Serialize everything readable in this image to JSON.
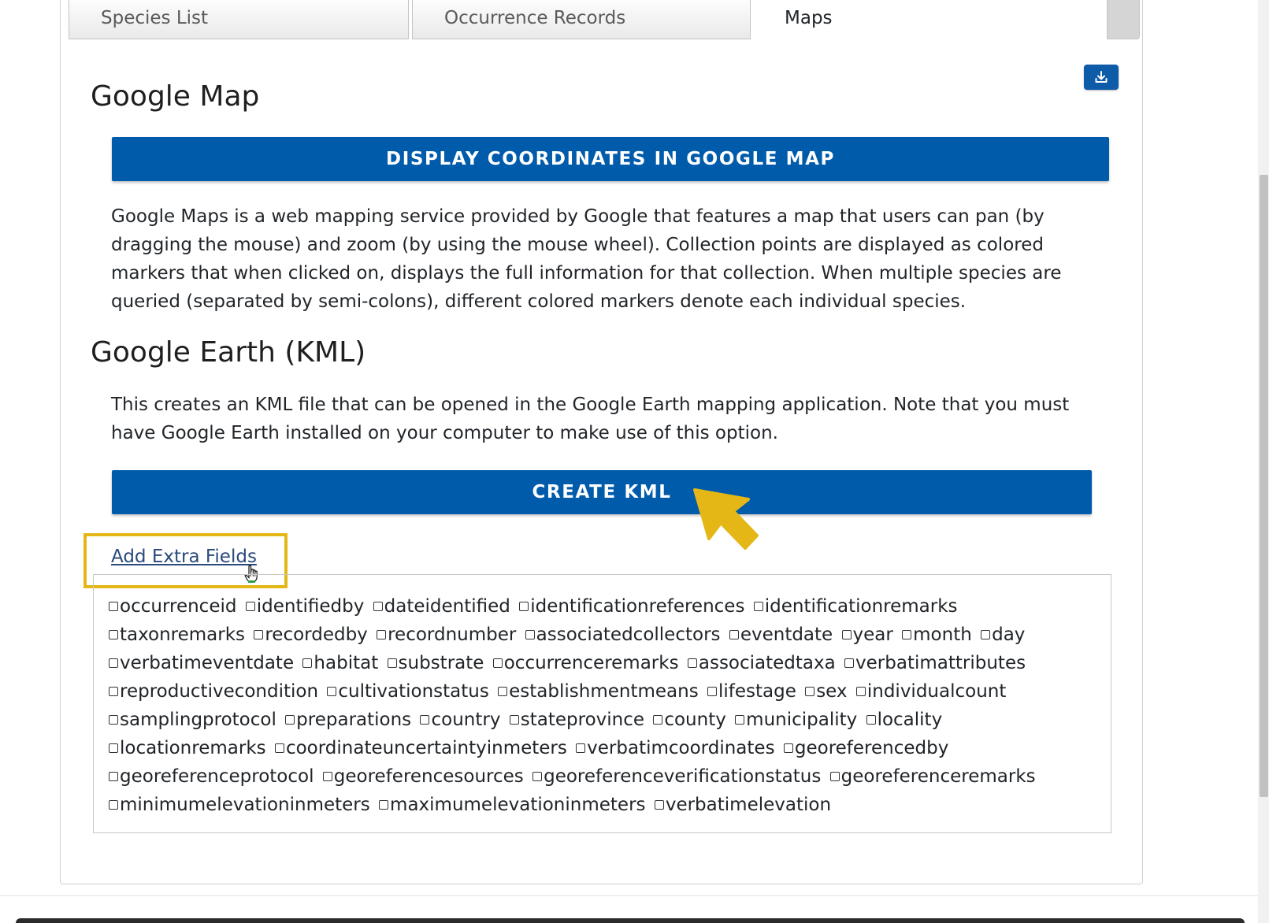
{
  "tabs": [
    {
      "label": "Species List"
    },
    {
      "label": "Occurrence Records"
    },
    {
      "label": "Maps",
      "active": true
    }
  ],
  "download_button": {
    "icon": "download-icon"
  },
  "google_map": {
    "heading": "Google Map",
    "button_label": "DISPLAY COORDINATES IN GOOGLE MAP",
    "description": "Google Maps is a web mapping service provided by Google that features a map that users can pan (by dragging the mouse) and zoom (by using the mouse wheel). Collection points are displayed as colored markers that when clicked on, displays the full information for that collection. When multiple species are queried (separated by semi-colons), different colored markers denote each individual species."
  },
  "google_earth": {
    "heading": "Google Earth (KML)",
    "description": "This creates an KML file that can be opened in the Google Earth mapping application. Note that you must have Google Earth installed on your computer to make use of this option.",
    "button_label": "CREATE KML"
  },
  "extra_fields": {
    "link_label": "Add Extra Fields",
    "fields": [
      "occurrenceid",
      "identifiedby",
      "dateidentified",
      "identificationreferences",
      "identificationremarks",
      "taxonremarks",
      "recordedby",
      "recordnumber",
      "associatedcollectors",
      "eventdate",
      "year",
      "month",
      "day",
      "verbatimeventdate",
      "habitat",
      "substrate",
      "occurrenceremarks",
      "associatedtaxa",
      "verbatimattributes",
      "reproductivecondition",
      "cultivationstatus",
      "establishmentmeans",
      "lifestage",
      "sex",
      "individualcount",
      "samplingprotocol",
      "preparations",
      "country",
      "stateprovince",
      "county",
      "municipality",
      "locality",
      "locationremarks",
      "coordinateuncertaintyinmeters",
      "verbatimcoordinates",
      "georeferencedby",
      "georeferenceprotocol",
      "georeferencesources",
      "georeferenceverificationstatus",
      "georeferenceremarks",
      "minimumelevationinmeters",
      "maximumelevationinmeters",
      "verbatimelevation"
    ]
  },
  "colors": {
    "primary_button": "#005bab",
    "highlight": "#e4b716",
    "arrow": "#e4b716"
  }
}
